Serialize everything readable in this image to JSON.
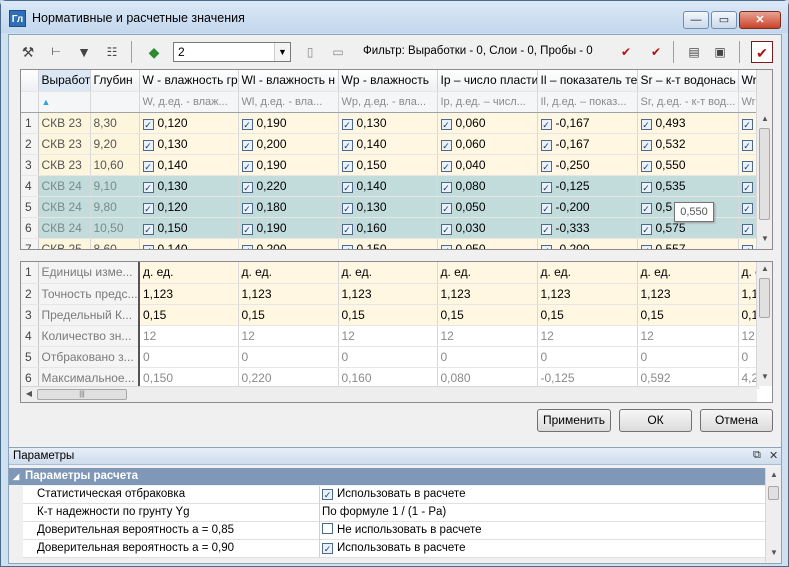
{
  "window": {
    "title": "Нормативные и расчетные значения",
    "app_icon": "Гл",
    "minimize": "—",
    "maximize": "▭",
    "close": "✕"
  },
  "toolbar": {
    "combo_value": "2",
    "filter_text": "Фильтр: Выработки - 0, Слои - 0, Пробы - 0",
    "icons": [
      "tools-icon",
      "tree-icon",
      "filter-icon",
      "grid-settings-icon",
      "layers-icon",
      "column-icon",
      "row-icon",
      "check-add-icon",
      "check-remove-icon",
      "report-icon",
      "export-icon",
      "checkbox-toggle-icon"
    ]
  },
  "top_grid": {
    "headers": [
      "Выработ",
      "Глубин",
      "W - влажность гр",
      "Wl - влажность н",
      "Wp - влажность",
      "Ip – число пласти",
      "Il – показатель те",
      "Sr – к-т водонась",
      "Wr"
    ],
    "subheaders": [
      "",
      "",
      "W, д.ед. - влаж...",
      "Wl, д.ед. - вла...",
      "Wp, д.ед. - вла...",
      "Ip, д.ед. – числ...",
      "Il, д.ед. – показ...",
      "Sr, д.ед. - к-т вод...",
      "Wr"
    ],
    "rows": [
      {
        "n": "1",
        "well": "СКВ 23",
        "depth": "8,30",
        "vals": [
          "0,120",
          "0,190",
          "0,130",
          "0,060",
          "-0,167",
          "0,493"
        ],
        "sel": false
      },
      {
        "n": "2",
        "well": "СКВ 23",
        "depth": "9,20",
        "vals": [
          "0,130",
          "0,200",
          "0,140",
          "0,060",
          "-0,167",
          "0,532"
        ],
        "sel": false
      },
      {
        "n": "3",
        "well": "СКВ 23",
        "depth": "10,60",
        "vals": [
          "0,140",
          "0,190",
          "0,150",
          "0,040",
          "-0,250",
          "0,550"
        ],
        "sel": false
      },
      {
        "n": "4",
        "well": "СКВ 24",
        "depth": "9,10",
        "vals": [
          "0,130",
          "0,220",
          "0,140",
          "0,080",
          "-0,125",
          "0,535"
        ],
        "sel": true
      },
      {
        "n": "5",
        "well": "СКВ 24",
        "depth": "9,80",
        "vals": [
          "0,120",
          "0,180",
          "0,130",
          "0,050",
          "-0,200",
          "0,5"
        ],
        "sel": true
      },
      {
        "n": "6",
        "well": "СКВ 24",
        "depth": "10,50",
        "vals": [
          "0,150",
          "0,190",
          "0,160",
          "0,030",
          "-0,333",
          "0,575"
        ],
        "sel": true
      },
      {
        "n": "7",
        "well": "СКВ 25",
        "depth": "8,60",
        "vals": [
          "0,140",
          "0,200",
          "0,150",
          "0,050",
          "-0,200",
          "0,557"
        ],
        "sel": false
      }
    ],
    "tooltip": "0,550"
  },
  "bottom_grid": {
    "rows": [
      {
        "n": "1",
        "label": "Единицы изме...",
        "vals": [
          "д. ед.",
          "д. ед.",
          "д. ед.",
          "д. ед.",
          "д. ед.",
          "д. ед.",
          "д. е"
        ],
        "gray": false
      },
      {
        "n": "2",
        "label": "Точность предс...",
        "vals": [
          "1,123",
          "1,123",
          "1,123",
          "1,123",
          "1,123",
          "1,123",
          "1,1"
        ],
        "gray": false
      },
      {
        "n": "3",
        "label": "Предельный К...",
        "vals": [
          "0,15",
          "0,15",
          "0,15",
          "0,15",
          "0,15",
          "0,15",
          "0,1"
        ],
        "gray": false
      },
      {
        "n": "4",
        "label": "Количество зн...",
        "vals": [
          "12",
          "12",
          "12",
          "12",
          "12",
          "12",
          "12"
        ],
        "gray": true
      },
      {
        "n": "5",
        "label": "Отбраковано з...",
        "vals": [
          "0",
          "0",
          "0",
          "0",
          "0",
          "0",
          "0"
        ],
        "gray": true
      },
      {
        "n": "6",
        "label": "Максимальное...",
        "vals": [
          "0,150",
          "0,220",
          "0,160",
          "0,080",
          "-0,125",
          "0,592",
          "4,2"
        ],
        "gray": true
      }
    ]
  },
  "buttons": {
    "apply": "Применить",
    "ok": "ОК",
    "cancel": "Отмена"
  },
  "params_panel": {
    "title": "Параметры",
    "section": "Параметры расчета",
    "rows": [
      {
        "label": "Статистическая отбраковка",
        "value": "Использовать в расчете",
        "checked": true,
        "has_check": true
      },
      {
        "label": "К-т надежности по грунту Yg",
        "value": "По формуле 1 / (1 - Pa)",
        "checked": false,
        "has_check": false
      },
      {
        "label": "Доверительная вероятность a = 0,85",
        "value": "Не использовать в расчете",
        "checked": false,
        "has_check": true
      },
      {
        "label": "Доверительная вероятность a = 0,90",
        "value": "Использовать в расчете",
        "checked": true,
        "has_check": true
      }
    ]
  }
}
